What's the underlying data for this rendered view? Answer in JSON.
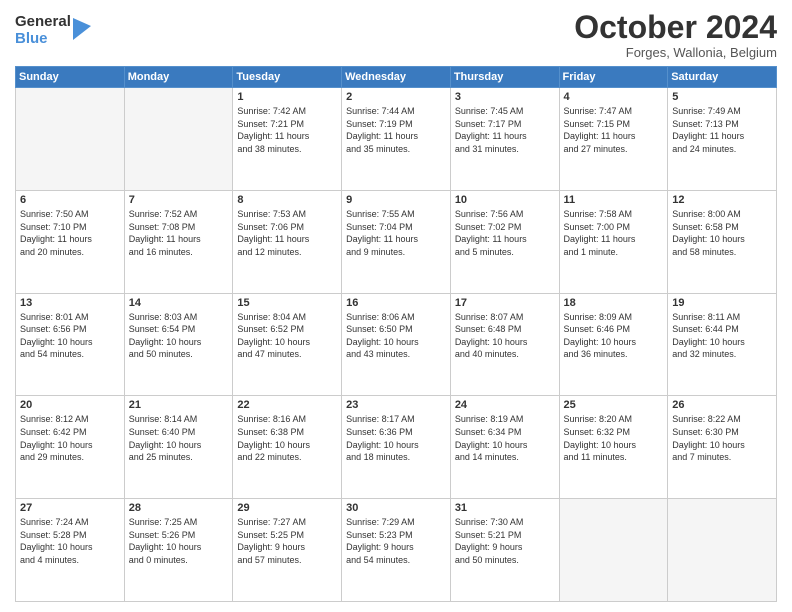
{
  "logo": {
    "general": "General",
    "blue": "Blue"
  },
  "header": {
    "month": "October 2024",
    "location": "Forges, Wallonia, Belgium"
  },
  "weekdays": [
    "Sunday",
    "Monday",
    "Tuesday",
    "Wednesday",
    "Thursday",
    "Friday",
    "Saturday"
  ],
  "weeks": [
    [
      {
        "day": "",
        "info": ""
      },
      {
        "day": "",
        "info": ""
      },
      {
        "day": "1",
        "info": "Sunrise: 7:42 AM\nSunset: 7:21 PM\nDaylight: 11 hours\nand 38 minutes."
      },
      {
        "day": "2",
        "info": "Sunrise: 7:44 AM\nSunset: 7:19 PM\nDaylight: 11 hours\nand 35 minutes."
      },
      {
        "day": "3",
        "info": "Sunrise: 7:45 AM\nSunset: 7:17 PM\nDaylight: 11 hours\nand 31 minutes."
      },
      {
        "day": "4",
        "info": "Sunrise: 7:47 AM\nSunset: 7:15 PM\nDaylight: 11 hours\nand 27 minutes."
      },
      {
        "day": "5",
        "info": "Sunrise: 7:49 AM\nSunset: 7:13 PM\nDaylight: 11 hours\nand 24 minutes."
      }
    ],
    [
      {
        "day": "6",
        "info": "Sunrise: 7:50 AM\nSunset: 7:10 PM\nDaylight: 11 hours\nand 20 minutes."
      },
      {
        "day": "7",
        "info": "Sunrise: 7:52 AM\nSunset: 7:08 PM\nDaylight: 11 hours\nand 16 minutes."
      },
      {
        "day": "8",
        "info": "Sunrise: 7:53 AM\nSunset: 7:06 PM\nDaylight: 11 hours\nand 12 minutes."
      },
      {
        "day": "9",
        "info": "Sunrise: 7:55 AM\nSunset: 7:04 PM\nDaylight: 11 hours\nand 9 minutes."
      },
      {
        "day": "10",
        "info": "Sunrise: 7:56 AM\nSunset: 7:02 PM\nDaylight: 11 hours\nand 5 minutes."
      },
      {
        "day": "11",
        "info": "Sunrise: 7:58 AM\nSunset: 7:00 PM\nDaylight: 11 hours\nand 1 minute."
      },
      {
        "day": "12",
        "info": "Sunrise: 8:00 AM\nSunset: 6:58 PM\nDaylight: 10 hours\nand 58 minutes."
      }
    ],
    [
      {
        "day": "13",
        "info": "Sunrise: 8:01 AM\nSunset: 6:56 PM\nDaylight: 10 hours\nand 54 minutes."
      },
      {
        "day": "14",
        "info": "Sunrise: 8:03 AM\nSunset: 6:54 PM\nDaylight: 10 hours\nand 50 minutes."
      },
      {
        "day": "15",
        "info": "Sunrise: 8:04 AM\nSunset: 6:52 PM\nDaylight: 10 hours\nand 47 minutes."
      },
      {
        "day": "16",
        "info": "Sunrise: 8:06 AM\nSunset: 6:50 PM\nDaylight: 10 hours\nand 43 minutes."
      },
      {
        "day": "17",
        "info": "Sunrise: 8:07 AM\nSunset: 6:48 PM\nDaylight: 10 hours\nand 40 minutes."
      },
      {
        "day": "18",
        "info": "Sunrise: 8:09 AM\nSunset: 6:46 PM\nDaylight: 10 hours\nand 36 minutes."
      },
      {
        "day": "19",
        "info": "Sunrise: 8:11 AM\nSunset: 6:44 PM\nDaylight: 10 hours\nand 32 minutes."
      }
    ],
    [
      {
        "day": "20",
        "info": "Sunrise: 8:12 AM\nSunset: 6:42 PM\nDaylight: 10 hours\nand 29 minutes."
      },
      {
        "day": "21",
        "info": "Sunrise: 8:14 AM\nSunset: 6:40 PM\nDaylight: 10 hours\nand 25 minutes."
      },
      {
        "day": "22",
        "info": "Sunrise: 8:16 AM\nSunset: 6:38 PM\nDaylight: 10 hours\nand 22 minutes."
      },
      {
        "day": "23",
        "info": "Sunrise: 8:17 AM\nSunset: 6:36 PM\nDaylight: 10 hours\nand 18 minutes."
      },
      {
        "day": "24",
        "info": "Sunrise: 8:19 AM\nSunset: 6:34 PM\nDaylight: 10 hours\nand 14 minutes."
      },
      {
        "day": "25",
        "info": "Sunrise: 8:20 AM\nSunset: 6:32 PM\nDaylight: 10 hours\nand 11 minutes."
      },
      {
        "day": "26",
        "info": "Sunrise: 8:22 AM\nSunset: 6:30 PM\nDaylight: 10 hours\nand 7 minutes."
      }
    ],
    [
      {
        "day": "27",
        "info": "Sunrise: 7:24 AM\nSunset: 5:28 PM\nDaylight: 10 hours\nand 4 minutes."
      },
      {
        "day": "28",
        "info": "Sunrise: 7:25 AM\nSunset: 5:26 PM\nDaylight: 10 hours\nand 0 minutes."
      },
      {
        "day": "29",
        "info": "Sunrise: 7:27 AM\nSunset: 5:25 PM\nDaylight: 9 hours\nand 57 minutes."
      },
      {
        "day": "30",
        "info": "Sunrise: 7:29 AM\nSunset: 5:23 PM\nDaylight: 9 hours\nand 54 minutes."
      },
      {
        "day": "31",
        "info": "Sunrise: 7:30 AM\nSunset: 5:21 PM\nDaylight: 9 hours\nand 50 minutes."
      },
      {
        "day": "",
        "info": ""
      },
      {
        "day": "",
        "info": ""
      }
    ]
  ]
}
